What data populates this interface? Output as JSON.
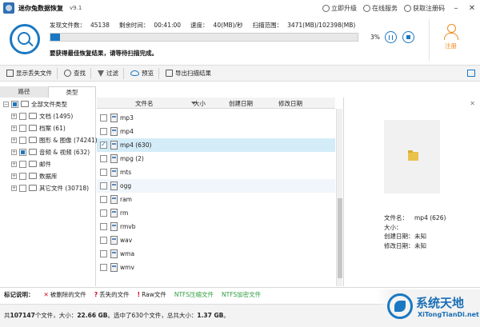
{
  "titlebar": {
    "app_title": "迷你兔数据恢复",
    "version": "v9.1",
    "upgrade": "立即升级",
    "online_service": "在线服务",
    "get_code": "获取注册码"
  },
  "scan": {
    "found_files_label": "发现文件数：",
    "found_files": "45138",
    "remaining_time_label": "剩余时间：",
    "remaining_time": "00:41:00",
    "speed_label": "速度：",
    "speed": "40(MB)/秒",
    "range_label": "扫描范围：",
    "range": "3471(MB)/102398(MB)",
    "progress_percent": 3,
    "progress_text": "3%",
    "tip": "要获得最佳恢复结果，请等待扫描完成。"
  },
  "register": {
    "label": "注册"
  },
  "toolbar": {
    "show_lost": "显示丢失文件",
    "find": "查找",
    "filter": "过滤",
    "preview": "预览",
    "export_results": "导出扫描结果"
  },
  "tabs": {
    "path": "路径",
    "type": "类型"
  },
  "tree": {
    "root": "全部文件类型",
    "items": [
      {
        "label": "文档 (1495)"
      },
      {
        "label": "档案 (61)"
      },
      {
        "label": "图形 & 图像 (74241)"
      },
      {
        "label": "音频 & 视频 (632)"
      },
      {
        "label": "邮件"
      },
      {
        "label": "数据库"
      },
      {
        "label": "其它文件 (30718)"
      }
    ]
  },
  "list": {
    "headers": {
      "name": "文件名",
      "size": "大小",
      "created": "创建日期",
      "modified": "修改日期"
    },
    "rows": [
      {
        "name": "mp3"
      },
      {
        "name": "mp4"
      },
      {
        "name": "mp4 (630)"
      },
      {
        "name": "mpg (2)"
      },
      {
        "name": "mts"
      },
      {
        "name": "ogg"
      },
      {
        "name": "ram"
      },
      {
        "name": "rm"
      },
      {
        "name": "rmvb"
      },
      {
        "name": "wav"
      },
      {
        "name": "wma"
      },
      {
        "name": "wmv"
      }
    ]
  },
  "preview": {
    "name_label": "文件名：",
    "name_value": "mp4 (626)",
    "size_label": "大小：",
    "size_value": "",
    "created_label": "创建日期：",
    "created_value": "未知",
    "modified_label": "修改日期：",
    "modified_value": "未知"
  },
  "legend": {
    "title": "标记说明：",
    "deleted": "被删除的文件",
    "lost": "丢失的文件",
    "raw": "Raw文件",
    "ntfs_compressed": "NTFS压缩文件",
    "ntfs_encrypted": "NTFS加密文件"
  },
  "status": {
    "prefix": "共",
    "total_files": "107147",
    "files_size_mid": "个文件，大小：",
    "total_size": "22.66 GB",
    "selected_mid": "。选中了630个文件，总共大小：",
    "selected_size": "1.37 GB",
    "suffix": "。"
  },
  "watermark": {
    "title": "系统天地",
    "url": "XiTongTianDi.net"
  },
  "colors": {
    "accent": "#1a78c2",
    "register": "#f08a1c",
    "ntfs": "#2e9e3f",
    "deleted": "#d0021b"
  }
}
